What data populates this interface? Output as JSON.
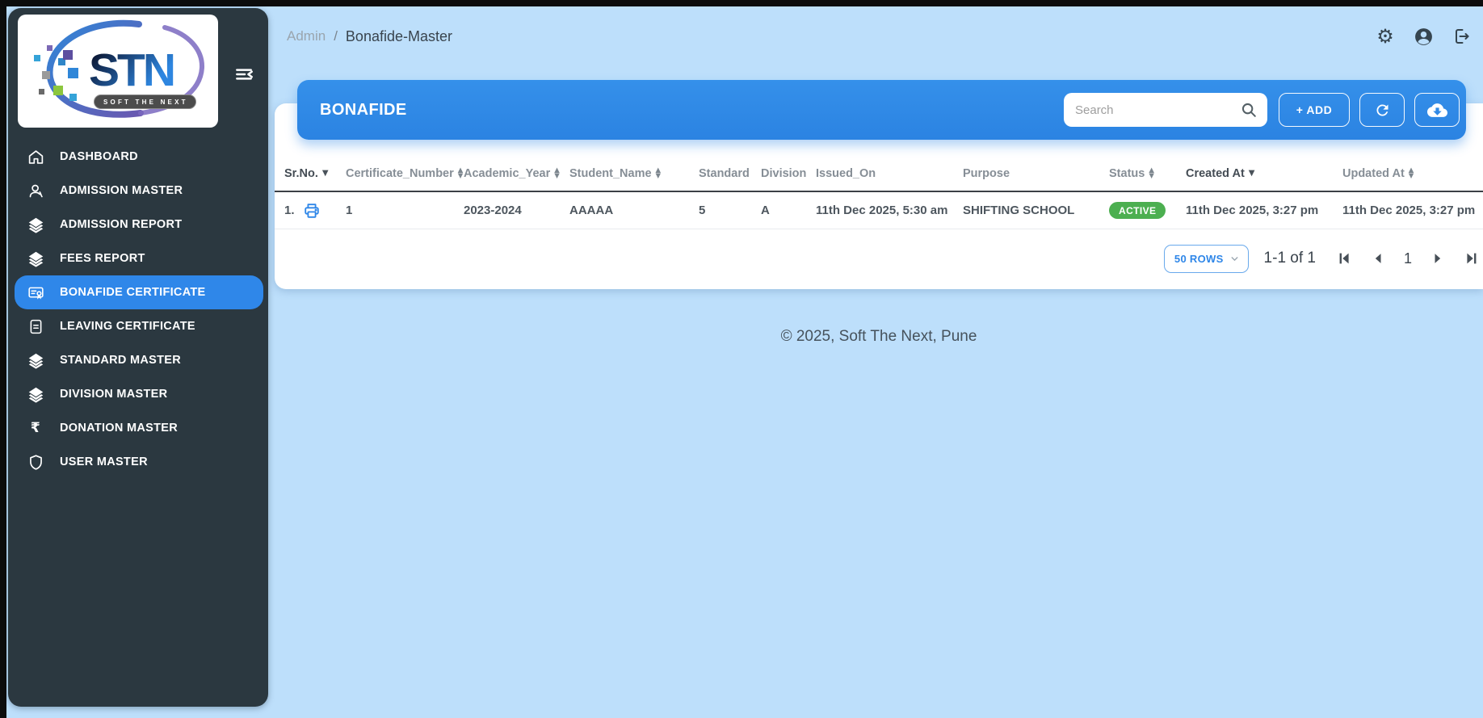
{
  "colors": {
    "page_bg": "#bddffb",
    "sidebar_bg": "#2b3840",
    "accent_blue": "#2e87e6",
    "active_item_blue": "#2f87e9",
    "badge_green": "#4caf50",
    "printer_blue": "#2e86e8"
  },
  "logo": {
    "text": "STN",
    "tagline": "SOFT THE NEXT"
  },
  "sidebar": {
    "items": [
      {
        "label": "DASHBOARD",
        "icon": "home-icon",
        "active": false
      },
      {
        "label": "ADMISSION MASTER",
        "icon": "person-icon",
        "active": false
      },
      {
        "label": "ADMISSION REPORT",
        "icon": "layers-icon",
        "active": false
      },
      {
        "label": "FEES REPORT",
        "icon": "layers-icon",
        "active": false
      },
      {
        "label": "BONAFIDE CERTIFICATE",
        "icon": "certificate-icon",
        "active": true
      },
      {
        "label": "LEAVING CERTIFICATE",
        "icon": "document-icon",
        "active": false
      },
      {
        "label": "STANDARD MASTER",
        "icon": "layers-icon",
        "active": false
      },
      {
        "label": "DIVISION MASTER",
        "icon": "layers-icon",
        "active": false
      },
      {
        "label": "DONATION MASTER",
        "icon": "rupee-icon",
        "active": false
      },
      {
        "label": "USER MASTER",
        "icon": "shield-icon",
        "active": false
      }
    ]
  },
  "header": {
    "breadcrumb": {
      "section": "Admin",
      "separator": "/",
      "page": "Bonafide-Master"
    },
    "icons": [
      "gear-icon",
      "account-icon",
      "logout-icon"
    ]
  },
  "panel": {
    "title": "BONAFIDE",
    "search_placeholder": "Search",
    "add_label": "+ ADD",
    "action_icons": [
      "search-icon",
      "refresh-icon",
      "cloud-download-icon"
    ]
  },
  "table": {
    "columns": [
      {
        "label": "Sr.No.",
        "sort": "desc"
      },
      {
        "label": "Certificate_Number",
        "sort": "both"
      },
      {
        "label": "Academic_Year",
        "sort": "both"
      },
      {
        "label": "Student_Name",
        "sort": "both"
      },
      {
        "label": "Standard",
        "sort": "none"
      },
      {
        "label": "Division",
        "sort": "none"
      },
      {
        "label": "Issued_On",
        "sort": "none"
      },
      {
        "label": "Purpose",
        "sort": "none"
      },
      {
        "label": "Status",
        "sort": "both"
      },
      {
        "label": "Created At",
        "sort": "desc"
      },
      {
        "label": "Updated At",
        "sort": "both"
      }
    ],
    "rows": [
      {
        "sr": "1.",
        "certificate_number": "1",
        "academic_year": "2023-2024",
        "student_name": "AAAAA",
        "standard": "5",
        "division": "A",
        "issued_on": "11th Dec 2025, 5:30 am",
        "purpose": "SHIFTING SCHOOL",
        "status": "ACTIVE",
        "created_at": "11th Dec 2025, 3:27 pm",
        "updated_at": "11th Dec 2025, 3:27 pm"
      }
    ]
  },
  "pagination": {
    "rows_per_page": "50 ROWS",
    "range": "1-1 of 1",
    "current_page": "1"
  },
  "footer": {
    "copyright": "© 2025, Soft The Next, Pune"
  },
  "icons": {
    "caret_down": "▼",
    "sort_up": "▲",
    "sort_down": "▼",
    "gear": "⚙",
    "rupee": "₹"
  }
}
